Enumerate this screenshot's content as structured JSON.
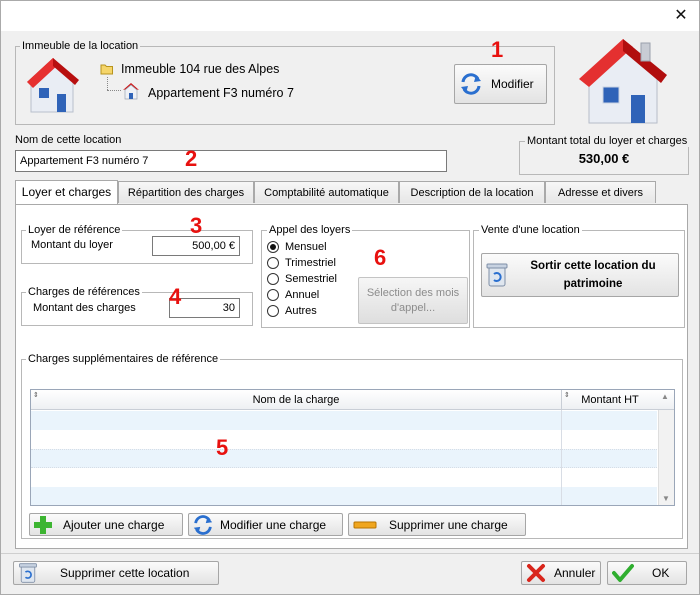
{
  "window": {
    "close_symbol": "✕"
  },
  "building_group": {
    "legend": "Immeuble de la location",
    "building_name": "Immeuble 104 rue des Alpes",
    "apartment_name": "Appartement F3 numéro 7",
    "modify_button": "Modifier"
  },
  "location_name": {
    "label": "Nom de cette location",
    "value": "Appartement F3 numéro 7"
  },
  "total": {
    "legend": "Montant total du loyer et charges",
    "value": "530,00 €"
  },
  "annotations": [
    "1",
    "2",
    "3",
    "4",
    "5",
    "6"
  ],
  "tabs": [
    {
      "label": "Loyer et charges"
    },
    {
      "label": "Répartition des charges"
    },
    {
      "label": "Comptabilité automatique"
    },
    {
      "label": "Description de la location"
    },
    {
      "label": "Adresse et divers"
    }
  ],
  "rent_ref": {
    "legend": "Loyer de référence",
    "label": "Montant du loyer",
    "value": "500,00 €"
  },
  "charges_ref": {
    "legend": "Charges de références",
    "label": "Montant des charges",
    "value": "30"
  },
  "call": {
    "legend": "Appel des loyers",
    "options": [
      "Mensuel",
      "Trimestriel",
      "Semestriel",
      "Annuel",
      "Autres"
    ],
    "selected": "Mensuel",
    "months_button_line1": "Sélection des mois",
    "months_button_line2": "d'appel..."
  },
  "sale": {
    "legend": "Vente d'une location",
    "button_line1": "Sortir cette location du",
    "button_line2": "patrimoine"
  },
  "extra_charges": {
    "legend": "Charges supplémentaires de référence",
    "columns": [
      "Nom de la charge",
      "Montant HT"
    ],
    "rows": [],
    "add_button": "Ajouter une charge",
    "modify_button": "Modifier une charge",
    "delete_button": "Supprimer une charge"
  },
  "footer": {
    "delete_location_button": "Supprimer cette location",
    "cancel_button": "Annuler",
    "ok_button": "OK"
  },
  "colors": {
    "roof": "#e01818",
    "house_wall": "#e9edf4",
    "annotation": "#e8110f",
    "refresh_blue": "#2a6fcf",
    "add_green": "#3db532",
    "cancel_red": "#d9261c",
    "ok_green": "#2fae2f"
  }
}
